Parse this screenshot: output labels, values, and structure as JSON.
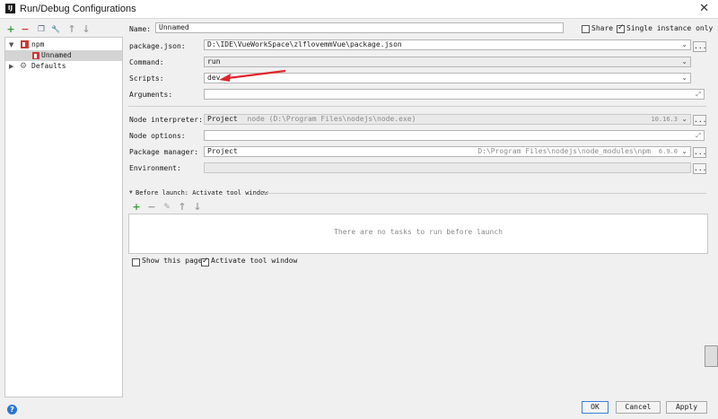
{
  "window": {
    "title": "Run/Debug Configurations",
    "close_glyph": "✕",
    "app_icon_glyph": "IJ"
  },
  "left_toolbar": {
    "add": "+",
    "remove": "−",
    "copy": "❐",
    "wrench": "🔧",
    "up": "↑",
    "down": "↓"
  },
  "tree": {
    "items": [
      {
        "label": "npm",
        "expanded": true
      },
      {
        "label": "Unnamed",
        "selected": true
      },
      {
        "label": "Defaults",
        "expanded": false
      }
    ]
  },
  "form": {
    "name_label": "Name:",
    "name_value": "Unnamed",
    "share_label": "Share",
    "share_checked": false,
    "single_instance_label": "Single instance only",
    "single_instance_checked": true,
    "package_json_label": "package.json:",
    "package_json_value": "D:\\IDE\\VueWorkSpace\\zlflovemmVue\\package.json",
    "command_label": "Command:",
    "command_value": "run",
    "scripts_label": "Scripts:",
    "scripts_value": "dev",
    "arguments_label": "Arguments:",
    "arguments_value": "",
    "node_interpreter_label": "Node interpreter:",
    "node_interpreter_value": "Project",
    "node_interpreter_path": "node (D:\\Program Files\\nodejs\\node.exe)",
    "node_interpreter_version": "10.16.3",
    "node_options_label": "Node options:",
    "node_options_value": "",
    "package_manager_label": "Package manager:",
    "package_manager_value": "Project",
    "package_manager_path": "D:\\Program Files\\nodejs\\node_modules\\npm",
    "package_manager_version": "6.9.0",
    "environment_label": "Environment:",
    "environment_value": "",
    "browse": "..."
  },
  "before_launch": {
    "header": "Before launch: Activate tool window",
    "toolbar": {
      "add": "+",
      "remove": "−",
      "edit": "✎",
      "up": "↑",
      "down": "↓"
    },
    "empty_text": "There are no tasks to run before launch",
    "show_page_label": "Show this page",
    "show_page_checked": false,
    "activate_tool_label": "Activate tool window",
    "activate_tool_checked": true
  },
  "buttons": {
    "ok": "OK",
    "cancel": "Cancel",
    "apply": "Apply",
    "help": "?"
  },
  "colors": {
    "annotation_arrow": "#e0262b",
    "npm_red": "#cb3837",
    "add_green": "#3a9a3a",
    "remove_red": "#d33c3c",
    "help_blue": "#2a77d4"
  }
}
